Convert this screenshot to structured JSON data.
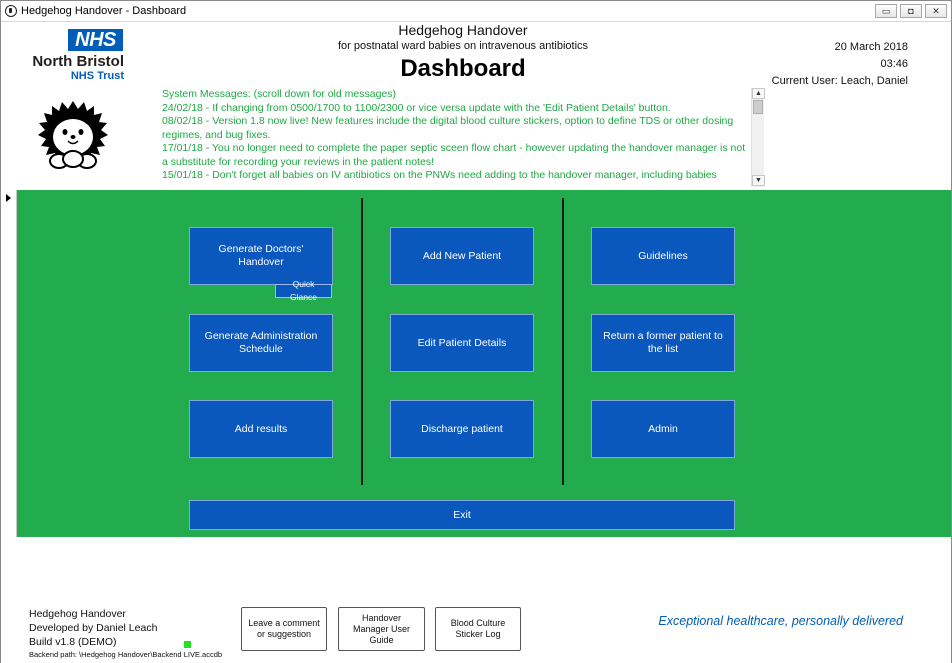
{
  "window": {
    "title": "Hedgehog Handover - Dashboard",
    "controls": {
      "minimize": "▭",
      "maximize": "◘",
      "close": "✕"
    }
  },
  "branding": {
    "logo_text": "NHS",
    "trust_name": "North Bristol",
    "trust_sub": "NHS Trust",
    "brand_color": "#005eb8",
    "mascot": "hedgehog-icon"
  },
  "header": {
    "app_title": "Hedgehog Handover",
    "app_subtitle": "for postnatal ward babies on intravenous antibiotics",
    "page_title": "Dashboard",
    "date": "20 March 2018",
    "time": "03:46",
    "current_user": "Current User: Leach, Daniel"
  },
  "messages": {
    "heading": "System Messages: (scroll down for old messages)",
    "items": [
      "24/02/18 - If changing from 0500/1700 to 1100/2300 or vice versa update with the 'Edit Patient Details' button.",
      "08/02/18 - Version 1.8 now live! New features include the digital blood culture stickers, option to define TDS or other dosing regimes, and bug fixes.",
      "17/01/18 - You no longer need to complete the paper septic sceen flow chart - however updating the handover manager is not a substitute for recording your reviews in the patient notes!",
      "15/01/18 - Don't forget all babies on IV antibiotics on the PNWs need adding to the handover manager, including babies"
    ],
    "text_color": "#21a845"
  },
  "panel": {
    "background": "#22ac4e",
    "button_color": "#0a57bd",
    "col1": {
      "generate_handover": "Generate Doctors' Handover",
      "quick_glance": "Quick Glance",
      "generate_admin": "Generate Administration Schedule",
      "add_results": "Add results"
    },
    "col2": {
      "add_patient": "Add New Patient",
      "edit_patient": "Edit Patient Details",
      "discharge": "Discharge patient"
    },
    "col3": {
      "guidelines": "Guidelines",
      "return_patient": "Return a former patient to the list",
      "admin": "Admin"
    },
    "exit": "Exit"
  },
  "footer": {
    "app_name": "Hedgehog Handover",
    "developer": "Developed by Daniel Leach",
    "build": "Build v1.8 (DEMO)",
    "backend_path": "Backend path: \\Hedgehog Handover\\Backend LIVE.accdb",
    "buttons": {
      "comment": "Leave a comment or suggestion",
      "user_guide": "Handover Manager User Guide",
      "sticker_log": "Blood Culture Sticker Log"
    },
    "tagline": "Exceptional healthcare, personally delivered",
    "status_color": "#22e022"
  }
}
